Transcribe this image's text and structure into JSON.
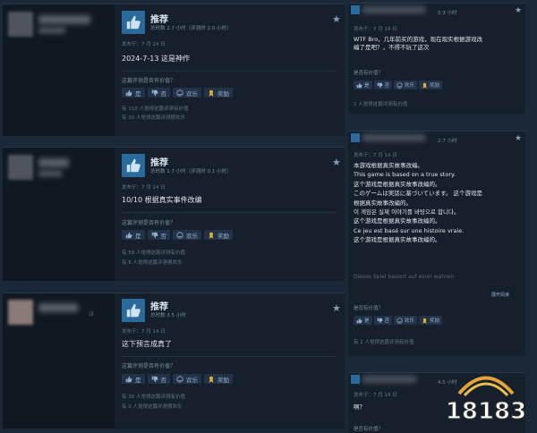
{
  "reviews": [
    {
      "verdict": "推荐",
      "hours": "总时数 2.7 小时（评测时 2.0 小时）",
      "posted": "发布于：7 月 14 日",
      "text": "2024-7-13 这是神作",
      "helpful_q": "这篇评测是否有价值？",
      "buttons": [
        "是",
        "否",
        "欢乐",
        "奖励"
      ],
      "stats": [
        "有 110 人觉得这篇评测有价值",
        "有 10 人觉得这篇评测很欢乐"
      ],
      "user_sub": ""
    },
    {
      "verdict": "推荐",
      "hours": "总时数 1.7 小时（评测时 0.1 小时）",
      "posted": "发布于：7 月 14 日",
      "text": "10/10 根据真实事件改编",
      "helpful_q": "这篇评测是否有价值？",
      "buttons": [
        "是",
        "否",
        "欢乐",
        "奖励"
      ],
      "stats": [
        "有 58 人觉得这篇评测有价值",
        "有 8 人觉得这篇评测很欢乐"
      ],
      "user_sub": ""
    },
    {
      "verdict": "推荐",
      "hours": "总时数 3.5 小时",
      "posted": "发布于：7 月 14 日",
      "text": "这下预言成真了",
      "helpful_q": "这篇评测是否有价值？",
      "buttons": [
        "是",
        "否",
        "欢乐",
        "奖励"
      ],
      "stats": [
        "有 30 人觉得这篇评测有价值",
        "有 0 人觉得这篇评测很欢乐"
      ],
      "user_sub": "详"
    }
  ],
  "right_reviews": [
    {
      "hours": "0.3 小时",
      "posted": "发布于：7 月 14 日",
      "lines": [
        "WTF Bro，几年前买的游戏，现在现实根据游戏改",
        "编了是吧？，不得不玩了这次"
      ],
      "helpful_q": "是否有价值？",
      "buttons": [
        "是",
        "否",
        "欢乐",
        "奖励"
      ],
      "stat": "1 人觉得这篇评测有价值"
    },
    {
      "hours": "2.7 小时",
      "posted": "发布于：7 月 14 日",
      "lines": [
        "本游戏根据真实故事改编。",
        "This game is based on a true story.",
        "这个游戏是根据真实故事改编的。",
        "このゲームは実話に基づいています。 这个游戏是",
        "根据真实故事改编的。",
        "이 게임은 실제 이야기를 바탕으로 합니다。",
        "这个游戏是根据真实故事改编的。",
        "Ce jeu est basé sur une histoire vraie.",
        "这个游戏是根据真实故事改编的。"
      ],
      "fade_line": "Dieses Spiel basiert auf einer wahren",
      "more": "展开阅读",
      "helpful_q": "是否有价值？",
      "buttons": [
        "是",
        "否",
        "欢乐",
        "奖励"
      ],
      "stat": "有 2 人觉得这篇评测有价值"
    },
    {
      "hours": "4.5 小时",
      "posted": "发布于：7 月 14 日",
      "lines": [
        "啊？"
      ],
      "helpful_q": "是否有价值？"
    }
  ],
  "watermark": "18183",
  "colors": {
    "bg": "#1b2838",
    "card": "#16202d",
    "thumb": "#2a6b9c",
    "accent": "#8fb2cf",
    "award": "#d8b03a"
  }
}
